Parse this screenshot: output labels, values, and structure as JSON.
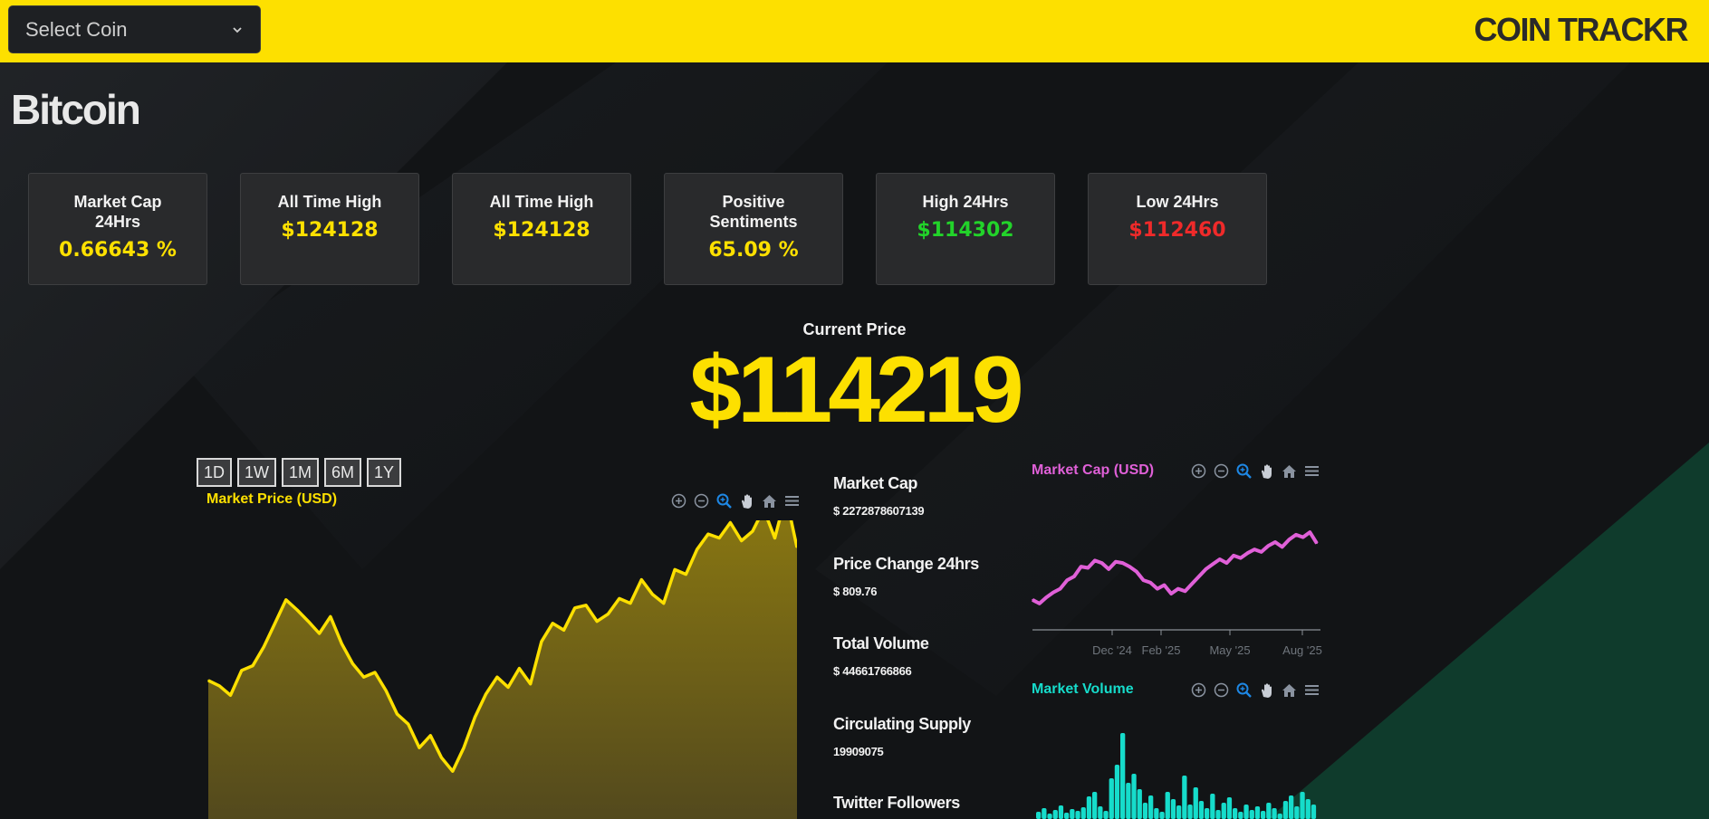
{
  "header": {
    "select": {
      "value": "Select Coin"
    },
    "brand": "COIN TRACKR",
    "colors": {
      "bar": "#fde000"
    }
  },
  "coin": {
    "name": "Bitcoin"
  },
  "stats": [
    {
      "label": "Market Cap 24Hrs",
      "value": "0.66643 %",
      "color": "#fde000"
    },
    {
      "label": "All Time High",
      "value": "$124128",
      "color": "#fde000"
    },
    {
      "label": "All Time High",
      "value": "$124128",
      "color": "#fde000"
    },
    {
      "label": "Positive Sentiments",
      "value": "65.09 %",
      "color": "#fde000"
    },
    {
      "label": "High 24Hrs",
      "value": "$114302",
      "color": "#22d32a"
    },
    {
      "label": "Low 24Hrs",
      "value": "$112460",
      "color": "#ef2a2a"
    }
  ],
  "current_price": {
    "label": "Current Price",
    "value": "$114219"
  },
  "range_buttons": [
    "1D",
    "1W",
    "1M",
    "6M",
    "1Y"
  ],
  "charts": {
    "price": {
      "title": "Market Price (USD)",
      "color": "#fde000"
    },
    "market_cap": {
      "title": "Market Cap (USD)",
      "color": "#e060d8",
      "xticks": [
        "Dec '24",
        "Feb '25",
        "May '25",
        "Aug '25"
      ]
    },
    "volume": {
      "title": "Market Volume",
      "color": "#16dccb"
    }
  },
  "toolbar_icons": [
    "zoom-in-icon",
    "zoom-out-icon",
    "zoom-select-icon",
    "pan-hand-icon",
    "home-reset-icon",
    "menu-icon"
  ],
  "metrics": [
    {
      "label": "Market Cap",
      "value": "$ 2272878607139"
    },
    {
      "label": "Price Change 24hrs",
      "value": "$ 809.76"
    },
    {
      "label": "Total Volume",
      "value": "$ 44661766866"
    },
    {
      "label": "Circulating Supply",
      "value": "19909075"
    },
    {
      "label": "Twitter Followers",
      "value": ""
    }
  ],
  "chart_data": [
    {
      "type": "area",
      "title": "Market Price (USD)",
      "series": [
        {
          "name": "Market Price (USD)",
          "values": [
            96000,
            95200,
            93800,
            97500,
            98200,
            101000,
            104500,
            108000,
            106500,
            104800,
            103000,
            105500,
            101500,
            98500,
            96500,
            97200,
            94500,
            91000,
            89500,
            86000,
            87800,
            84500,
            82500,
            86000,
            90500,
            94000,
            96500,
            95000,
            97800,
            95500,
            101800,
            104500,
            103500,
            106800,
            107200,
            104800,
            105900,
            108200,
            107500,
            111000,
            108800,
            107500,
            112500,
            111800,
            115500,
            117800,
            117200,
            119500,
            116800,
            118200,
            121500,
            117200,
            123500,
            115800
          ]
        }
      ]
    },
    {
      "type": "line",
      "title": "Market Cap (USD)",
      "x": [
        "Dec '24",
        "Feb '25",
        "May '25",
        "Aug '25"
      ],
      "series": [
        {
          "name": "Market Cap (USD)",
          "values": [
            1.89,
            1.86,
            1.91,
            1.95,
            1.98,
            2.05,
            2.08,
            2.16,
            2.15,
            2.21,
            2.19,
            2.14,
            2.2,
            2.19,
            2.16,
            2.12,
            2.05,
            2.03,
            1.98,
            2.01,
            1.94,
            1.98,
            1.96,
            2.02,
            2.08,
            2.14,
            2.18,
            2.22,
            2.19,
            2.25,
            2.23,
            2.27,
            2.3,
            2.28,
            2.33,
            2.36,
            2.32,
            2.38,
            2.42,
            2.4,
            2.44,
            2.35
          ]
        }
      ]
    },
    {
      "type": "bar",
      "title": "Market Volume",
      "series": [
        {
          "name": "Market Volume",
          "values": [
            8,
            12,
            6,
            10,
            15,
            7,
            11,
            9,
            13,
            25,
            30,
            14,
            9,
            45,
            60,
            95,
            40,
            50,
            33,
            18,
            26,
            12,
            8,
            30,
            22,
            15,
            48,
            16,
            35,
            20,
            12,
            28,
            10,
            18,
            24,
            12,
            8,
            16,
            10,
            14,
            9,
            18,
            12,
            6,
            20,
            26,
            14,
            30,
            22,
            16
          ]
        }
      ]
    }
  ]
}
